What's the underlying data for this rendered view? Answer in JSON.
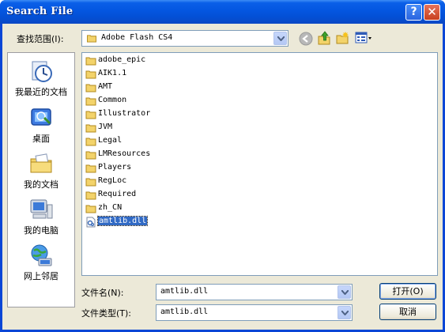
{
  "window": {
    "title": "Search File"
  },
  "toolbar": {
    "look_in_label": "查找范围(I):",
    "look_in_value": "Adobe Flash CS4"
  },
  "places": [
    {
      "label": "我最近的文档",
      "icon": "recent-documents-icon"
    },
    {
      "label": "桌面",
      "icon": "desktop-icon"
    },
    {
      "label": "我的文档",
      "icon": "my-documents-icon"
    },
    {
      "label": "我的电脑",
      "icon": "my-computer-icon"
    },
    {
      "label": "网上邻居",
      "icon": "network-places-icon"
    }
  ],
  "files": [
    {
      "name": "adobe_epic",
      "type": "folder"
    },
    {
      "name": "AIK1.1",
      "type": "folder"
    },
    {
      "name": "AMT",
      "type": "folder"
    },
    {
      "name": "Common",
      "type": "folder"
    },
    {
      "name": "Illustrator",
      "type": "folder"
    },
    {
      "name": "JVM",
      "type": "folder"
    },
    {
      "name": "Legal",
      "type": "folder"
    },
    {
      "name": "LMResources",
      "type": "folder"
    },
    {
      "name": "Players",
      "type": "folder"
    },
    {
      "name": "RegLoc",
      "type": "folder"
    },
    {
      "name": "Required",
      "type": "folder"
    },
    {
      "name": "zh_CN",
      "type": "folder"
    },
    {
      "name": "amtlib.dll",
      "type": "file",
      "selected": true
    }
  ],
  "form": {
    "filename_label": "文件名(N):",
    "filename_value": "amtlib.dll",
    "filetype_label": "文件类型(T):",
    "filetype_value": "amtlib.dll",
    "open_label": "打开(O)",
    "cancel_label": "取消"
  },
  "colors": {
    "titlebar": "#0350d6",
    "dialog_bg": "#ece9d8",
    "selection": "#316ac5",
    "folder": "#f3d36a"
  }
}
